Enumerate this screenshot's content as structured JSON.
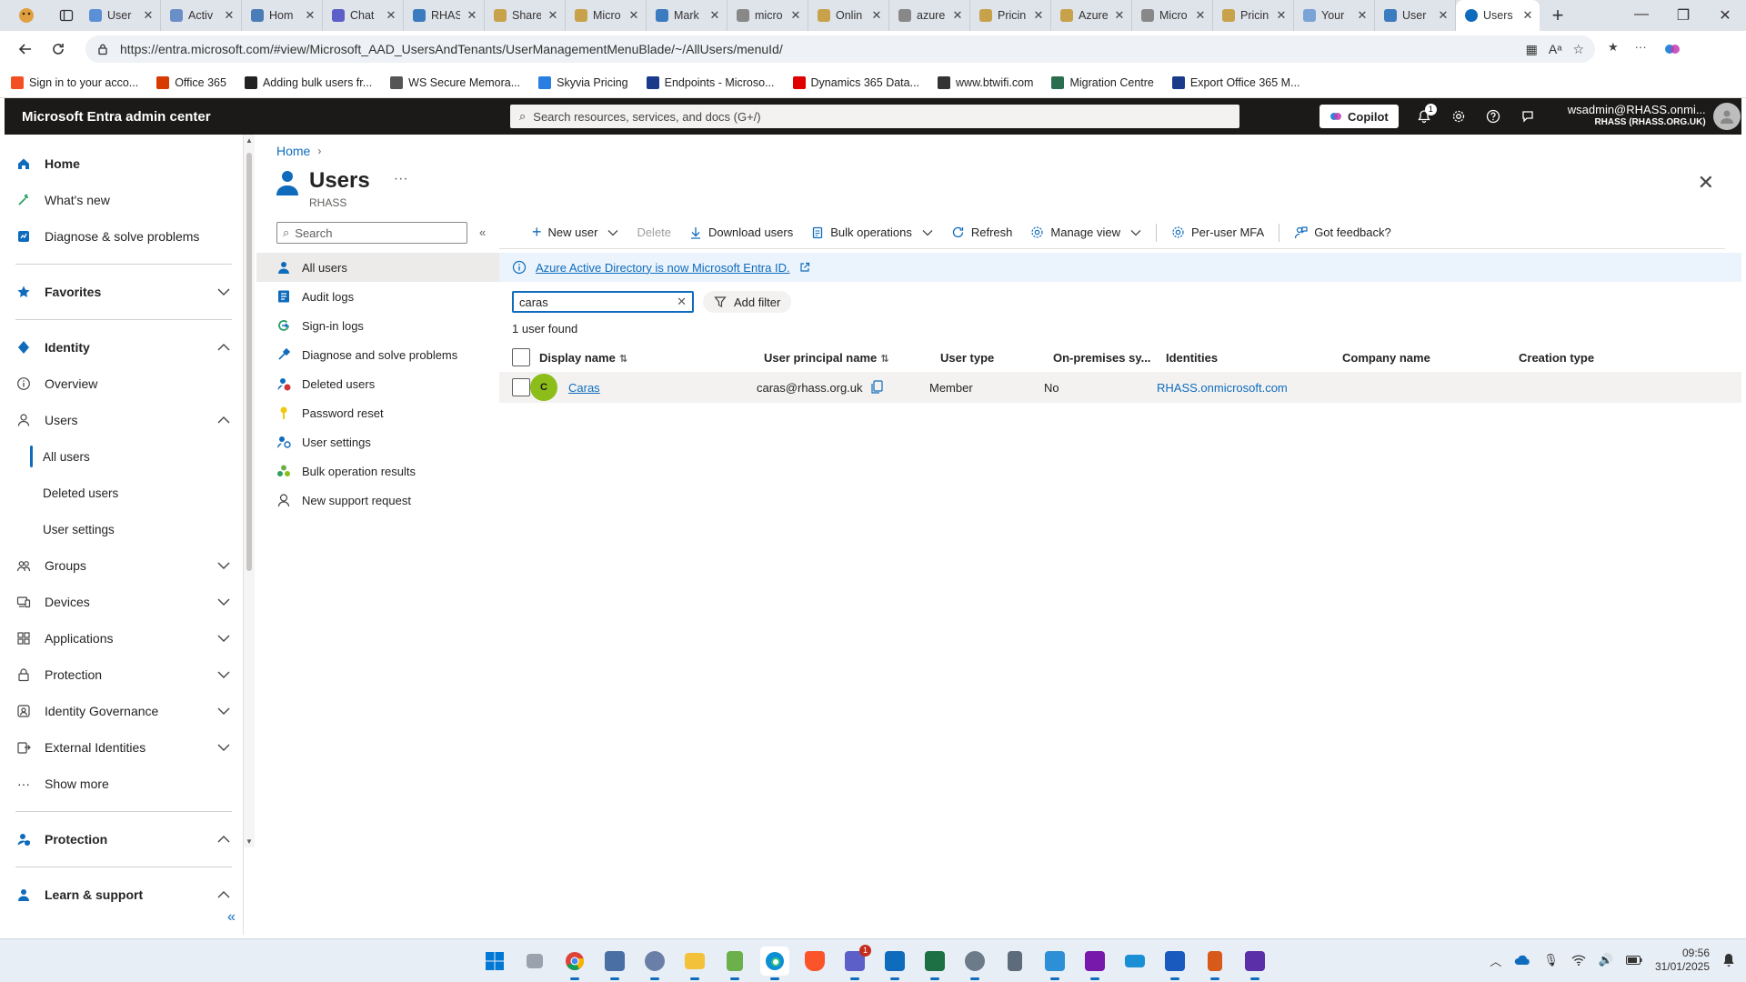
{
  "browser": {
    "tabs": [
      {
        "label": "User",
        "color": "#5b8fd6"
      },
      {
        "label": "Activ",
        "color": "#6a8fc7"
      },
      {
        "label": "Hom",
        "color": "#4a7db8"
      },
      {
        "label": "Chat",
        "color": "#5b5fc7"
      },
      {
        "label": "RHAS",
        "color": "#3b7bbf"
      },
      {
        "label": "Share",
        "color": "#c8a24a"
      },
      {
        "label": "Micro",
        "color": "#c8a24a"
      },
      {
        "label": "Mark",
        "color": "#3b7bbf"
      },
      {
        "label": "micro",
        "color": "#888888"
      },
      {
        "label": "Onlin",
        "color": "#c8a24a"
      },
      {
        "label": "azure",
        "color": "#888888"
      },
      {
        "label": "Pricin",
        "color": "#c8a24a"
      },
      {
        "label": "Azure",
        "color": "#c8a24a"
      },
      {
        "label": "Micro",
        "color": "#888888"
      },
      {
        "label": "Pricin",
        "color": "#c8a24a"
      },
      {
        "label": "Your",
        "color": "#7aa3d6"
      },
      {
        "label": "User",
        "color": "#3b7bbf"
      }
    ],
    "active_tab": {
      "label": "Users",
      "color": "#0f6cbd"
    },
    "url": "https://entra.microsoft.com/#view/Microsoft_AAD_UsersAndTenants/UserManagementMenuBlade/~/AllUsers/menuId/",
    "bookmarks": [
      {
        "label": "Sign in to your acco...",
        "color": "#f25022"
      },
      {
        "label": "Office 365",
        "color": "#d83b01"
      },
      {
        "label": "Adding bulk users fr...",
        "color": "#222222"
      },
      {
        "label": "WS Secure Memora...",
        "color": "#555555"
      },
      {
        "label": "Skyvia Pricing",
        "color": "#2a7de1"
      },
      {
        "label": "Endpoints - Microso...",
        "color": "#1a3a8a"
      },
      {
        "label": "Dynamics 365 Data...",
        "color": "#e00000"
      },
      {
        "label": "www.btwifi.com",
        "color": "#333333"
      },
      {
        "label": "Migration Centre",
        "color": "#2b6e4f"
      },
      {
        "label": "Export Office 365 M...",
        "color": "#1a3a8a"
      }
    ]
  },
  "portal": {
    "brand": "Microsoft Entra admin center",
    "search_placeholder": "Search resources, services, and docs (G+/)",
    "copilot_label": "Copilot",
    "notification_count": "1",
    "account_name": "wsadmin@RHASS.onmi...",
    "account_tenant": "RHASS (RHASS.ORG.UK)"
  },
  "leftnav": {
    "home": "Home",
    "whats_new": "What's new",
    "diagnose": "Diagnose & solve problems",
    "favorites": "Favorites",
    "identity": "Identity",
    "overview": "Overview",
    "users": "Users",
    "all_users": "All users",
    "deleted_users": "Deleted users",
    "user_settings": "User settings",
    "groups": "Groups",
    "devices": "Devices",
    "applications": "Applications",
    "protection": "Protection",
    "identity_governance": "Identity Governance",
    "external_identities": "External Identities",
    "show_more": "Show more",
    "protection_section": "Protection",
    "learn_support": "Learn & support"
  },
  "page": {
    "breadcrumb_home": "Home",
    "title": "Users",
    "subtitle": "RHASS"
  },
  "blade_menu": {
    "search_placeholder": "Search",
    "items": [
      "All users",
      "Audit logs",
      "Sign-in logs",
      "Diagnose and solve problems",
      "Deleted users",
      "Password reset",
      "User settings",
      "Bulk operation results",
      "New support request"
    ]
  },
  "toolbar": {
    "new_user": "New user",
    "delete": "Delete",
    "download_users": "Download users",
    "bulk_operations": "Bulk operations",
    "refresh": "Refresh",
    "manage_view": "Manage view",
    "per_user_mfa": "Per-user MFA",
    "feedback": "Got feedback?"
  },
  "banner": {
    "text": "Azure Active Directory is now Microsoft Entra ID."
  },
  "filter": {
    "search_value": "caras",
    "add_filter": "Add filter",
    "result_count": "1 user found"
  },
  "table": {
    "columns": [
      "Display name",
      "User principal name",
      "User type",
      "On-premises sy...",
      "Identities",
      "Company name",
      "Creation type"
    ],
    "rows": [
      {
        "initial": "C",
        "display_name": "Caras",
        "upn": "caras@rhass.org.uk",
        "user_type": "Member",
        "on_prem": "No",
        "identities": "RHASS.onmicrosoft.com",
        "company": "",
        "creation": ""
      }
    ]
  },
  "taskbar": {
    "notification_badge": "1",
    "time": "09:56",
    "date": "31/01/2025"
  }
}
